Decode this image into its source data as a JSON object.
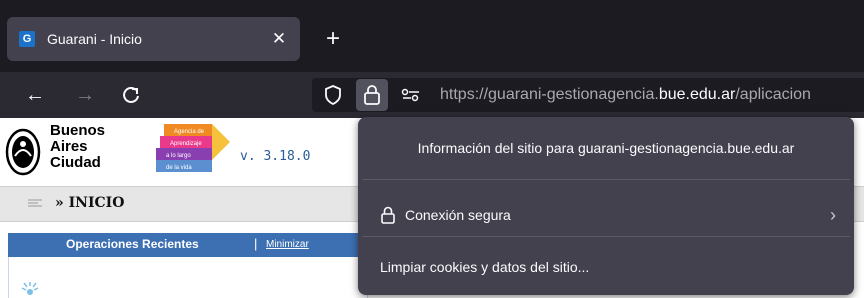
{
  "browser": {
    "tab": {
      "title": "Guarani - Inicio",
      "favicon_letter": "G",
      "close_icon": "close-icon"
    },
    "new_tab_icon": "plus-icon",
    "nav": {
      "back_icon": "arrow-left-icon",
      "forward_icon": "arrow-right-icon",
      "reload_icon": "reload-icon"
    },
    "url": {
      "scheme": "https://",
      "subdomain": "guarani-gestionagencia.",
      "domain": "bue.edu.ar",
      "path": "/aplicacion"
    },
    "colors": {
      "tabstrip": "#1c1b22",
      "toolbar": "#2b2a33",
      "popup": "#42414d",
      "text": "#fbfbfe"
    }
  },
  "page": {
    "logo_lines": [
      "Buenos",
      "Aires",
      "Ciudad"
    ],
    "agency_lines": [
      "Agencia de",
      "Aprendizaje",
      "a lo largo",
      "de la vida"
    ],
    "version": "v. 3.18.0",
    "breadcrumb": "» INICIO",
    "recent_ops": {
      "title": "Operaciones Recientes",
      "separator": "|",
      "minimize": "Minimizar"
    }
  },
  "site_info_popup": {
    "title": "Información del sitio para guarani-gestionagencia.bue.edu.ar",
    "secure_connection": "Conexión segura",
    "clear_cookies": "Limpiar cookies y datos del sitio..."
  }
}
